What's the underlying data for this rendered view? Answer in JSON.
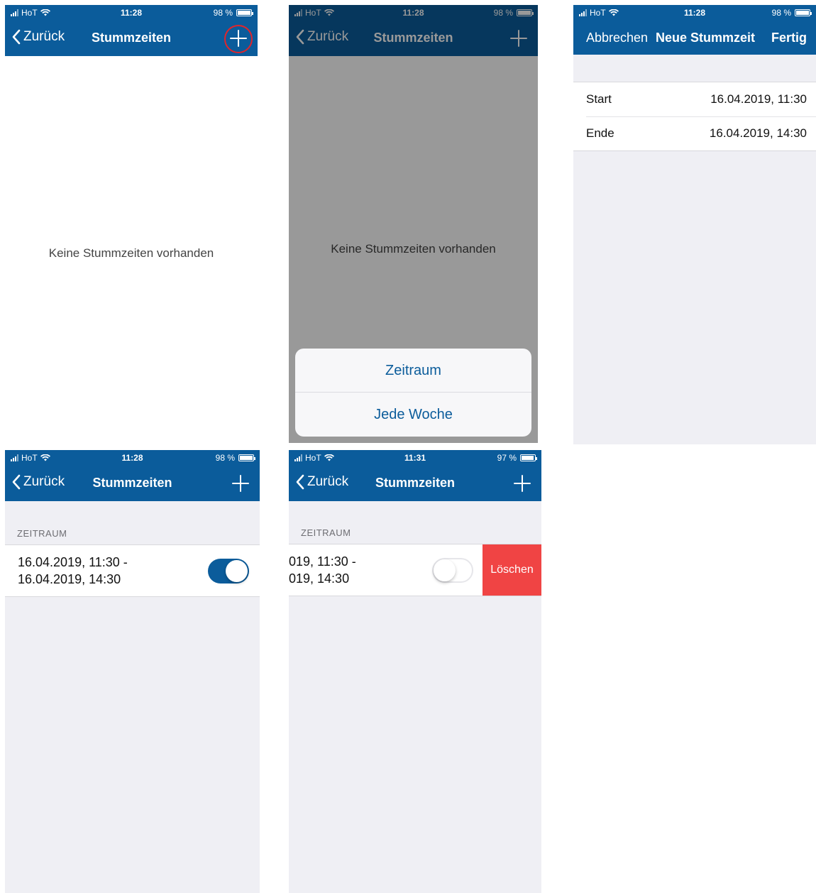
{
  "status": {
    "carrier": "HoT",
    "time": "11:28",
    "time_later": "11:31",
    "battery": "98 %",
    "battery_later": "97 %",
    "battery_level": 0.98,
    "battery_level_later": 0.97
  },
  "nav": {
    "back_label": "Zurück",
    "title": "Stummzeiten"
  },
  "empty_state": "Keine Stummzeiten vorhanden",
  "action_sheet": {
    "items": [
      "Zeitraum",
      "Jede Woche"
    ]
  },
  "new_modal": {
    "cancel": "Abbrechen",
    "title": "Neue Stummzeit",
    "done": "Fertig",
    "rows": [
      {
        "label": "Start",
        "value": "16.04.2019, 11:30"
      },
      {
        "label": "Ende",
        "value": "16.04.2019, 14:30"
      }
    ]
  },
  "list": {
    "section": "ZEITRAUM",
    "item_line1": "16.04.2019, 11:30 -",
    "item_line2": "16.04.2019, 14:30",
    "item_line1_shifted": "019, 11:30 -",
    "item_line2_shifted": "019, 14:30",
    "toggle_on": true,
    "delete_label": "Löschen"
  },
  "colors": {
    "brand": "#0b5c9b",
    "destructive": "#f04444",
    "highlight_ring": "#e0252b",
    "grouped_bg": "#efeff4"
  },
  "icons": [
    "signal-icon",
    "wifi-icon",
    "battery-icon",
    "chevron-left-icon",
    "plus-icon"
  ]
}
